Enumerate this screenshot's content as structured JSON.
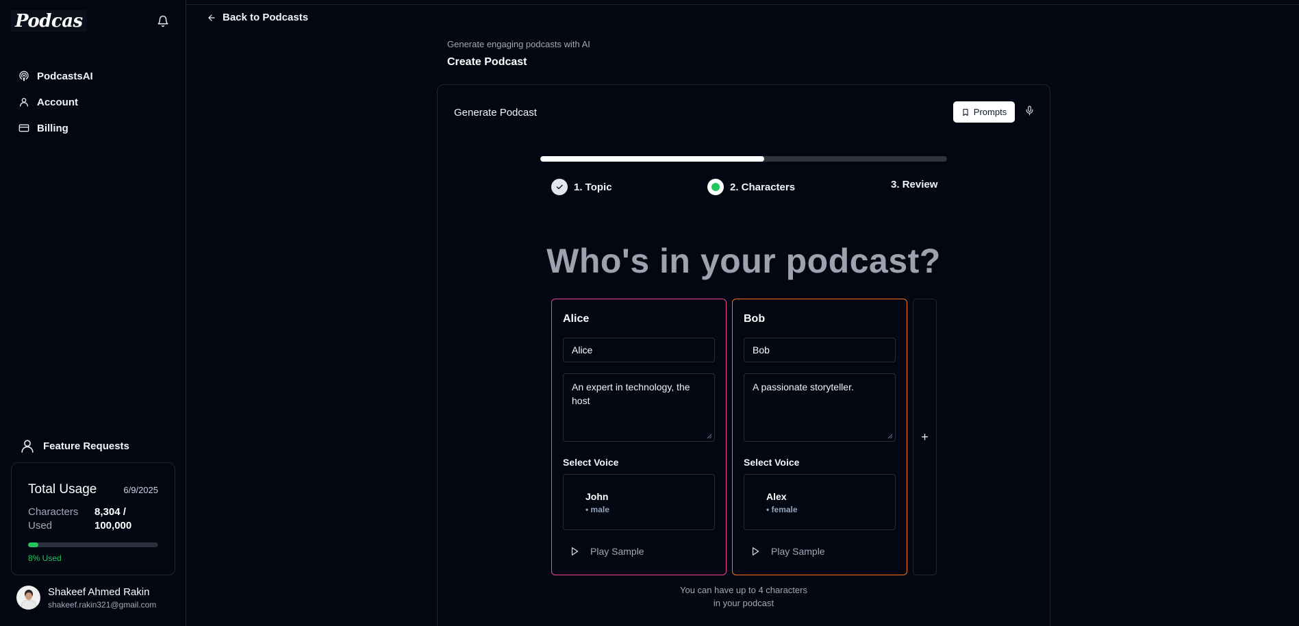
{
  "sidebar": {
    "logo": "Podcas",
    "nav": [
      {
        "label": "PodcastsAI",
        "icon": "podcast-icon"
      },
      {
        "label": "Account",
        "icon": "user-icon"
      },
      {
        "label": "Billing",
        "icon": "credit-card-icon"
      }
    ],
    "feature_requests": "Feature Requests",
    "usage": {
      "title": "Total Usage",
      "date": "6/9/2025",
      "label": "Characters Used",
      "value": "8,304 / 100,000",
      "percent": 8,
      "percent_text": "8% Used"
    },
    "user": {
      "name": "Shakeef Ahmed Rakin",
      "email": "shakeef.rakin321@gmail.com"
    }
  },
  "main": {
    "back_label": "Back to Podcasts",
    "subtitle": "Generate engaging podcasts with AI",
    "title": "Create Podcast",
    "card": {
      "title": "Generate Podcast",
      "prompts_label": "Prompts",
      "progress": 0.55,
      "steps": [
        {
          "label": "1. Topic",
          "state": "done"
        },
        {
          "label": "2. Characters",
          "state": "active"
        },
        {
          "label": "3. Review",
          "state": "pending"
        }
      ],
      "heading": "Who's in your podcast?",
      "characters": [
        {
          "title": "Alice",
          "name": "Alice",
          "description": "An expert in technology, the host",
          "voice_label": "Select Voice",
          "voice": "John",
          "gender": "• male",
          "play_label": "Play Sample",
          "accent": "#ec4899"
        },
        {
          "title": "Bob",
          "name": "Bob",
          "description": "A passionate storyteller.",
          "voice_label": "Select Voice",
          "voice": "Alex",
          "gender": "• female",
          "play_label": "Play Sample",
          "accent": "#f97316"
        }
      ],
      "add_label": "+",
      "note_line1": "You can have up to 4 characters",
      "note_line2": "in your podcast"
    }
  },
  "colors": {
    "background": "#030711",
    "success": "#22c55e",
    "alice_accent": "#ec4899",
    "bob_accent": "#f97316"
  }
}
